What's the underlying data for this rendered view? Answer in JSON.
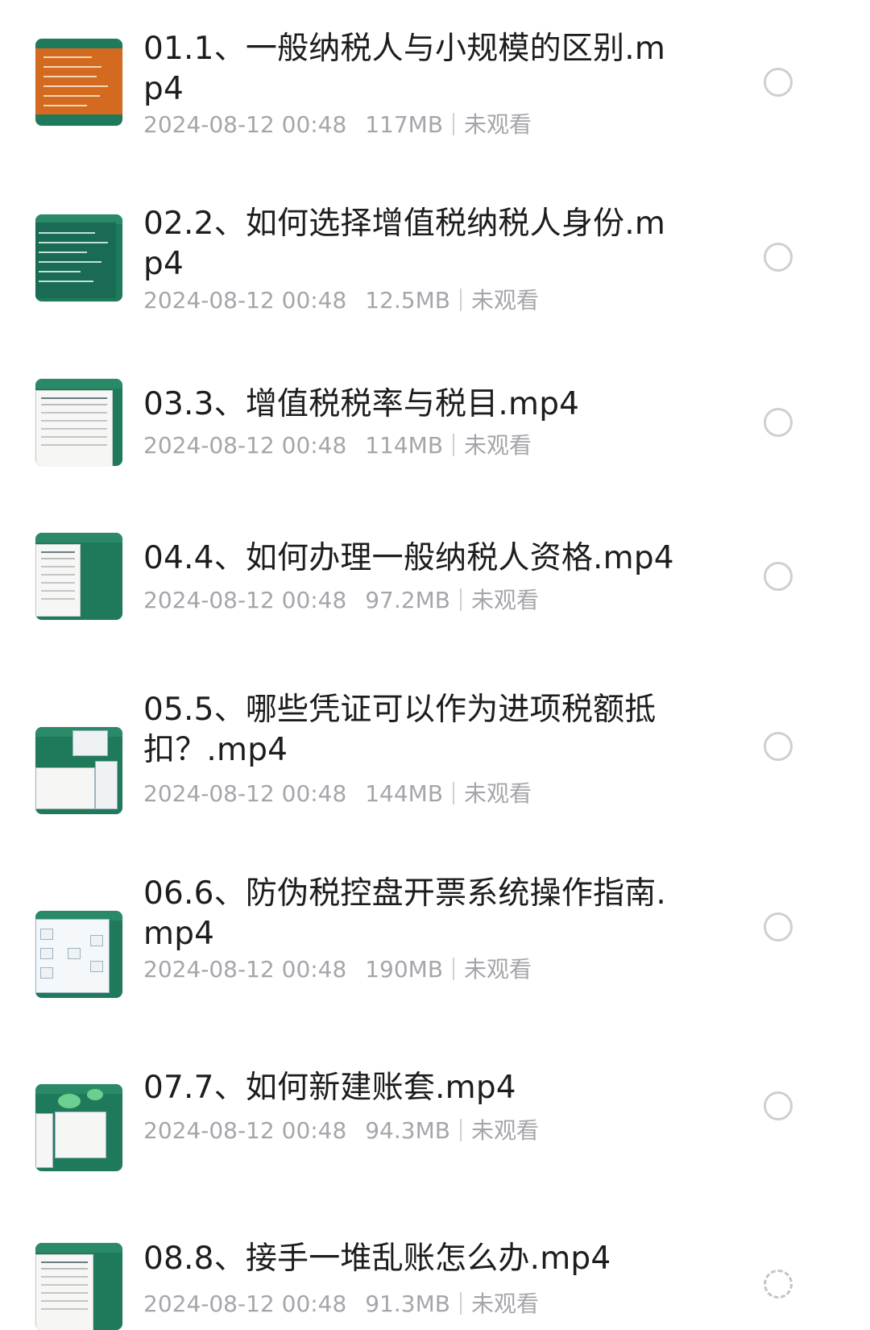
{
  "files": [
    {
      "title": "01.1、一般纳税人与小规模的区别.mp4",
      "date": "2024-08-12 00:48",
      "size": "117MB",
      "status": "未观看",
      "thumb_style": "orange-board"
    },
    {
      "title": "02.2、如何选择增值税纳税人身份.mp4",
      "date": "2024-08-12 00:48",
      "size": "12.5MB",
      "status": "未观看",
      "thumb_style": "dark-text"
    },
    {
      "title": "03.3、增值税税率与税目.mp4",
      "date": "2024-08-12 00:48",
      "size": "114MB",
      "status": "未观看",
      "thumb_style": "document"
    },
    {
      "title": "04.4、如何办理一般纳税人资格.mp4",
      "date": "2024-08-12 00:48",
      "size": "97.2MB",
      "status": "未观看",
      "thumb_style": "document"
    },
    {
      "title": "05.5、哪些凭证可以作为进项税额抵扣？.mp4",
      "date": "2024-08-12 00:48",
      "size": "144MB",
      "status": "未观看",
      "thumb_style": "screen"
    },
    {
      "title": "06.6、防伪税控盘开票系统操作指南.mp4",
      "date": "2024-08-12 00:48",
      "size": "190MB",
      "status": "未观看",
      "thumb_style": "flow"
    },
    {
      "title": "07.7、如何新建账套.mp4",
      "date": "2024-08-12 00:48",
      "size": "94.3MB",
      "status": "未观看",
      "thumb_style": "mindmap"
    },
    {
      "title": "08.8、接手一堆乱账怎么办.mp4",
      "date": "2024-08-12 00:48",
      "size": "91.3MB",
      "status": "未观看",
      "thumb_style": "spreadsheet"
    }
  ],
  "colors": {
    "thumb_green": "#1f7a5c",
    "meta_gray": "#a5a6ab",
    "radio_border": "#cdcfd3",
    "title_text": "#1d1d1f"
  },
  "icons": {
    "select": "radio-circle-icon"
  }
}
